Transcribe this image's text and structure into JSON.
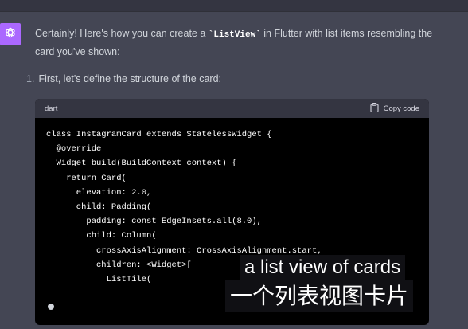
{
  "assistant": {
    "avatar_icon": "openai-logo-icon",
    "avatar_color": "#ab68ff",
    "message_before_code": "Certainly! Here's how you can create a ",
    "message_code": "`ListView`",
    "message_after_code": " in Flutter with list items resembling the card you've shown:",
    "step_number": "1.",
    "step_text": "First, let's define the structure of the card:"
  },
  "code_block": {
    "language": "dart",
    "copy_label": "Copy code",
    "copy_icon": "clipboard-icon",
    "lines": [
      "class InstagramCard extends StatelessWidget {",
      "  @override",
      "  Widget build(BuildContext context) {",
      "    return Card(",
      "      elevation: 2.0,",
      "      child: Padding(",
      "        padding: const EdgeInsets.all(8.0),",
      "        child: Column(",
      "          crossAxisAlignment: CrossAxisAlignment.start,",
      "          children: <Widget>[",
      "            ListTile("
    ]
  },
  "subtitles": {
    "english": "a list view of cards",
    "chinese": "一个列表视图卡片"
  }
}
